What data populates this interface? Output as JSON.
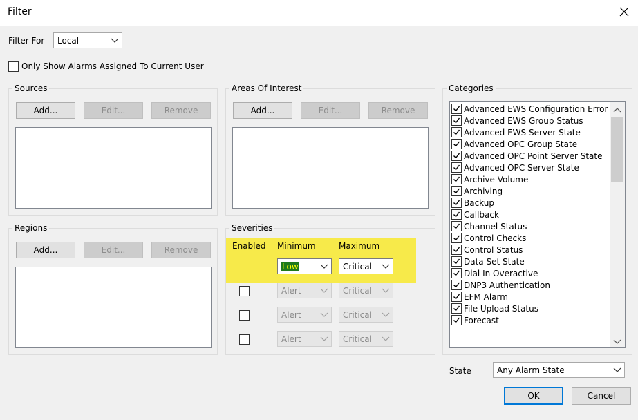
{
  "window": {
    "title": "Filter"
  },
  "filter_for": {
    "label": "Filter For",
    "value": "Local"
  },
  "only_show": {
    "label": "Only Show Alarms Assigned To Current User",
    "checked": false
  },
  "sources": {
    "title": "Sources",
    "add": "Add...",
    "edit": "Edit...",
    "remove": "Remove"
  },
  "areas": {
    "title": "Areas Of Interest",
    "add": "Add...",
    "edit": "Edit...",
    "remove": "Remove"
  },
  "regions": {
    "title": "Regions",
    "add": "Add...",
    "edit": "Edit...",
    "remove": "Remove"
  },
  "severities": {
    "title": "Severities",
    "col_enabled": "Enabled",
    "col_min": "Minimum",
    "col_max": "Maximum",
    "active_row": {
      "min": "Low",
      "max": "Critical"
    },
    "rows": [
      {
        "min": "Alert",
        "max": "Critical",
        "enabled": false
      },
      {
        "min": "Alert",
        "max": "Critical",
        "enabled": false
      },
      {
        "min": "Alert",
        "max": "Critical",
        "enabled": false
      }
    ]
  },
  "categories": {
    "title": "Categories",
    "items": [
      "Advanced EWS Configuration Error",
      "Advanced EWS Group Status",
      "Advanced EWS Server State",
      "Advanced OPC Group State",
      "Advanced OPC Point Server State",
      "Advanced OPC Server State",
      "Archive Volume",
      "Archiving",
      "Backup",
      "Callback",
      "Channel Status",
      "Control Checks",
      "Control Status",
      "Data Set State",
      "Dial In Overactive",
      "DNP3 Authentication",
      "EFM Alarm",
      "File Upload Status",
      "Forecast"
    ]
  },
  "state": {
    "label": "State",
    "value": "Any Alarm State"
  },
  "buttons": {
    "ok": "OK",
    "cancel": "Cancel"
  },
  "colors": {
    "highlight": "#f7ea4a",
    "accent": "#0078d7",
    "selection": "#1e7a1e"
  }
}
